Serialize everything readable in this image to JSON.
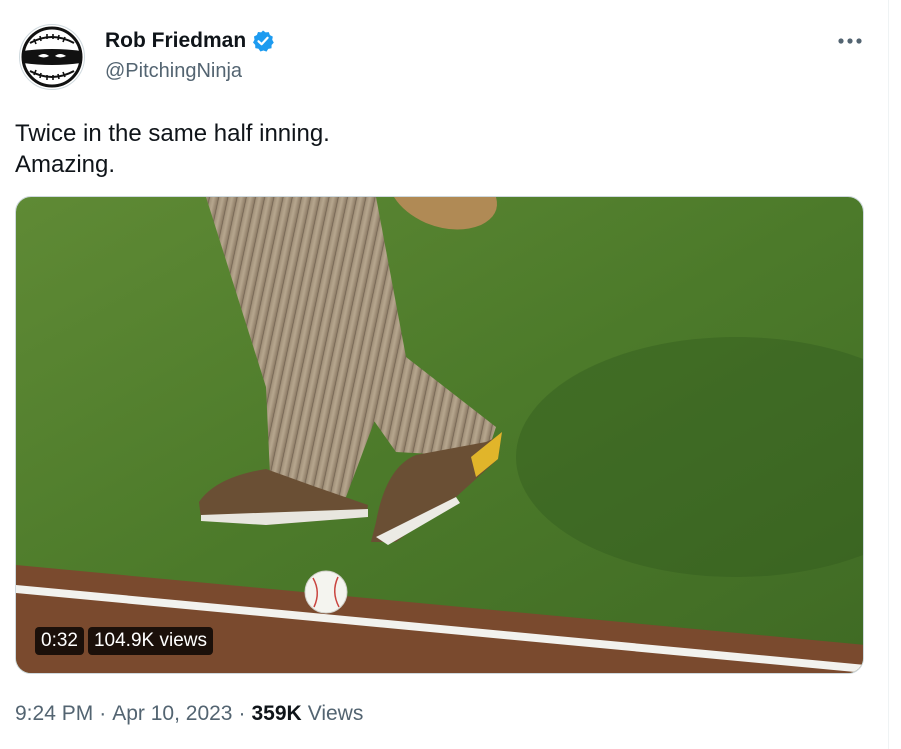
{
  "author": {
    "name": "Rob Friedman",
    "handle": "@PitchingNinja",
    "verified": true,
    "avatar_icon": "ninja-baseball-avatar",
    "verified_color": "#1d9bf0"
  },
  "more_icon": "ellipsis-icon",
  "tweet": {
    "lines": [
      "Twice in the same half inning.",
      "Amazing."
    ]
  },
  "media": {
    "type": "video",
    "duration": "0:32",
    "views": "104.9K views"
  },
  "meta": {
    "time": "9:24 PM",
    "separator": "·",
    "date": "Apr 10, 2023",
    "views_count": "359K",
    "views_label": "Views"
  },
  "colors": {
    "text": "#0f1419",
    "secondary": "#536471",
    "grass": "#4f7a2c",
    "dirt": "#7a4a2e"
  }
}
